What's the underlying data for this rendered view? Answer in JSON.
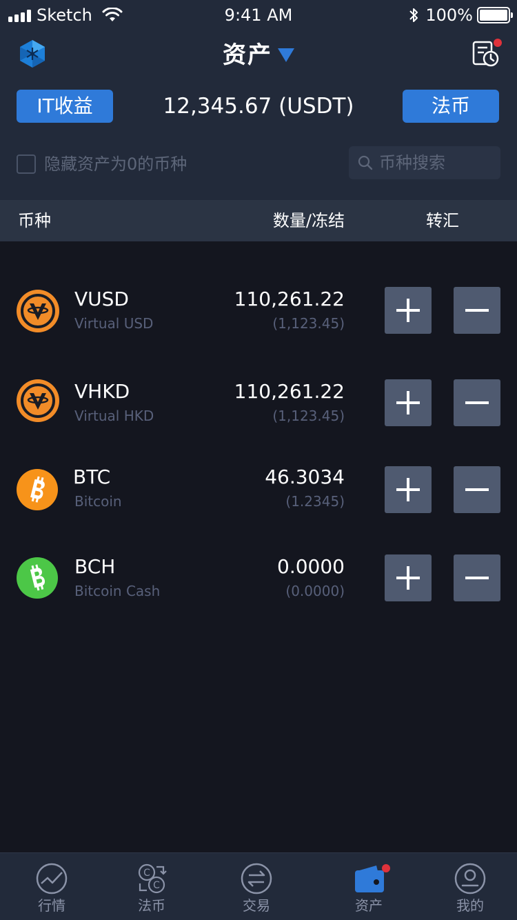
{
  "status_bar": {
    "carrier": "Sketch",
    "time": "9:41 AM",
    "battery": "100%"
  },
  "header": {
    "title": "资产"
  },
  "balance_row": {
    "it_button": "IT收益",
    "total": "12,345.67 (USDT)",
    "fiat_button": "法币"
  },
  "filter": {
    "hide_zero_label": "隐藏资产为0的币种",
    "search_placeholder": "币种搜索"
  },
  "table_header": {
    "coin": "币种",
    "quantity": "数量/冻结",
    "transfer": "转汇"
  },
  "assets": [
    {
      "symbol": "VUSD",
      "name": "Virtual USD",
      "amount": "110,261.22",
      "frozen": "(1,123.45)",
      "icon": "vusd-coin-icon"
    },
    {
      "symbol": "VHKD",
      "name": "Virtual HKD",
      "amount": "110,261.22",
      "frozen": "(1,123.45)",
      "icon": "vhkd-coin-icon"
    },
    {
      "symbol": "BTC",
      "name": "Bitcoin",
      "amount": "46.3034",
      "frozen": "(1.2345)",
      "icon": "bitcoin-icon"
    },
    {
      "symbol": "BCH",
      "name": "Bitcoin Cash",
      "amount": "0.0000",
      "frozen": "(0.0000)",
      "icon": "bitcoin-cash-icon"
    }
  ],
  "tabs": [
    {
      "label": "行情",
      "icon": "market-chart-icon"
    },
    {
      "label": "法币",
      "icon": "fiat-exchange-icon"
    },
    {
      "label": "交易",
      "icon": "trade-swap-icon"
    },
    {
      "label": "资产",
      "icon": "wallet-icon",
      "active": true
    },
    {
      "label": "我的",
      "icon": "profile-icon"
    }
  ],
  "colors": {
    "accent": "#2f7ad9",
    "background": "#14161f",
    "panel": "#222a3a",
    "notification": "#e0323b",
    "vusd": "#f28c28",
    "btc": "#f7931a",
    "bch": "#4cc747"
  }
}
